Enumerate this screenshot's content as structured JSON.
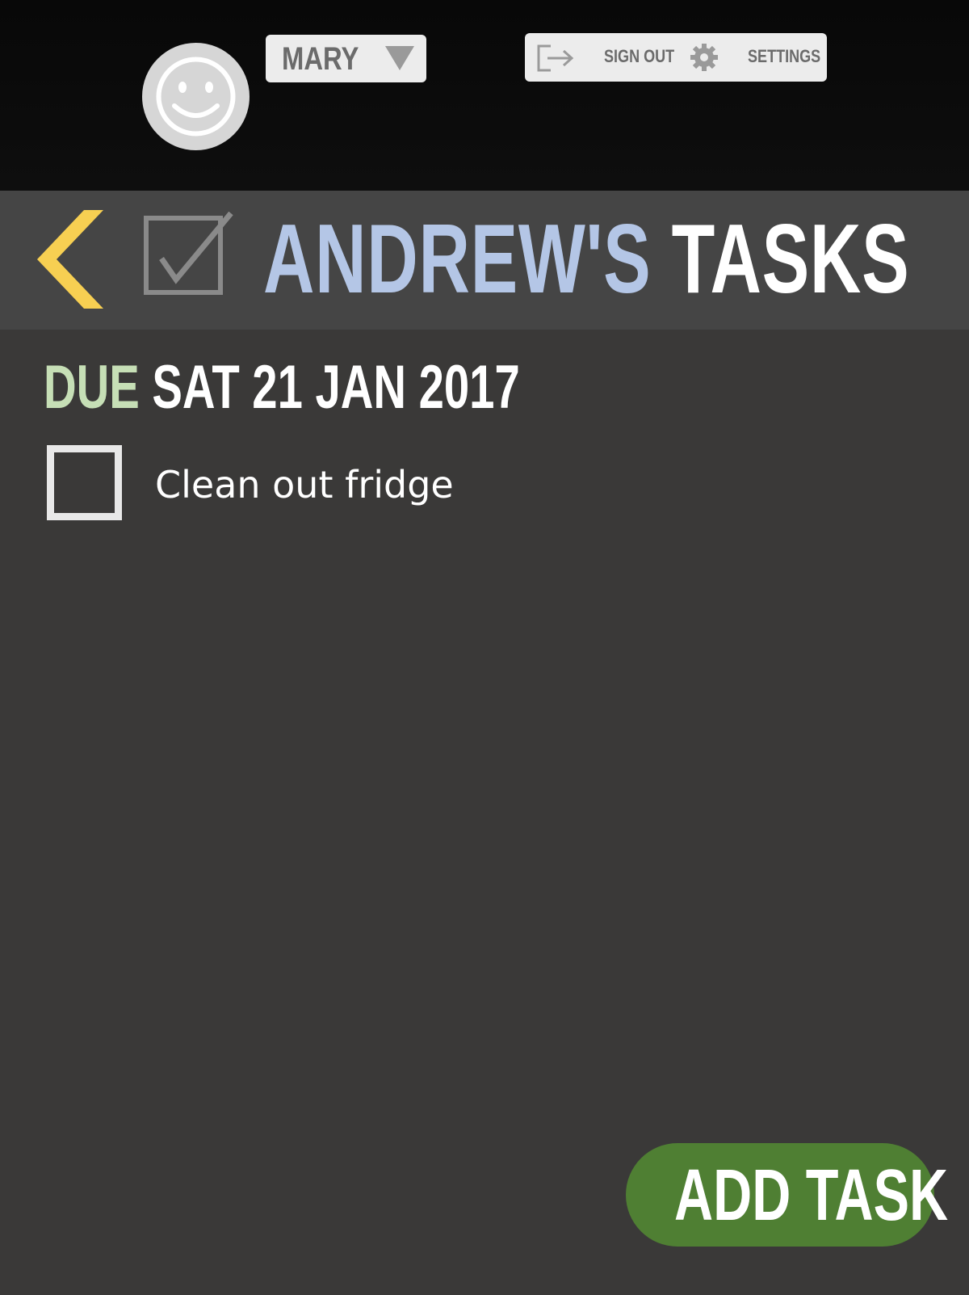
{
  "header": {
    "avatar_icon": "smiley-face-icon",
    "current_user": "MARY",
    "user_dropdown_icon": "triangle-down-icon",
    "sign_out_label": "SIGN OUT",
    "sign_out_icon": "sign-out-icon",
    "settings_label": "SETTINGS",
    "settings_icon": "gear-icon"
  },
  "titlebar": {
    "back_icon": "chevron-left-icon",
    "tasks_icon": "checked-box-icon",
    "owner": "ANDREW'S",
    "title_word": "TASKS"
  },
  "tasks_group": {
    "due_label": "DUE",
    "due_date": "SAT 21 JAN 2017",
    "items": [
      {
        "label": "Clean out fridge",
        "checked": false
      }
    ]
  },
  "actions": {
    "add_task_label": "ADD TASK"
  },
  "colors": {
    "accent_back": "#f7cf52",
    "owner_text": "#b4c6e6",
    "due_text": "#c6dfb6",
    "add_button": "#4f7f33"
  }
}
